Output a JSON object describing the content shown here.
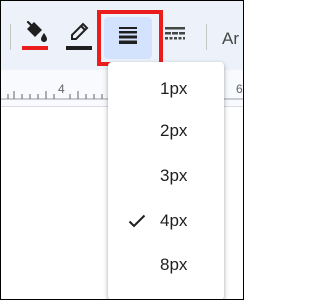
{
  "colors": {
    "highlight": "#ea1c1c",
    "active_bg": "#d3e3fd",
    "toolbar_bg": "#edf2fa"
  },
  "toolbar": {
    "fill_color_icon": "paint-bucket",
    "border_color_icon": "pencil",
    "border_width_icon": "line-weight",
    "border_dash_icon": "line-dash",
    "overflow_text": "Ar"
  },
  "ruler": {
    "numbers": [
      "4",
      "6"
    ]
  },
  "menu": {
    "items": [
      {
        "label": "1px",
        "checked": false
      },
      {
        "label": "2px",
        "checked": false
      },
      {
        "label": "3px",
        "checked": false
      },
      {
        "label": "4px",
        "checked": true
      },
      {
        "label": "8px",
        "checked": false
      }
    ]
  }
}
